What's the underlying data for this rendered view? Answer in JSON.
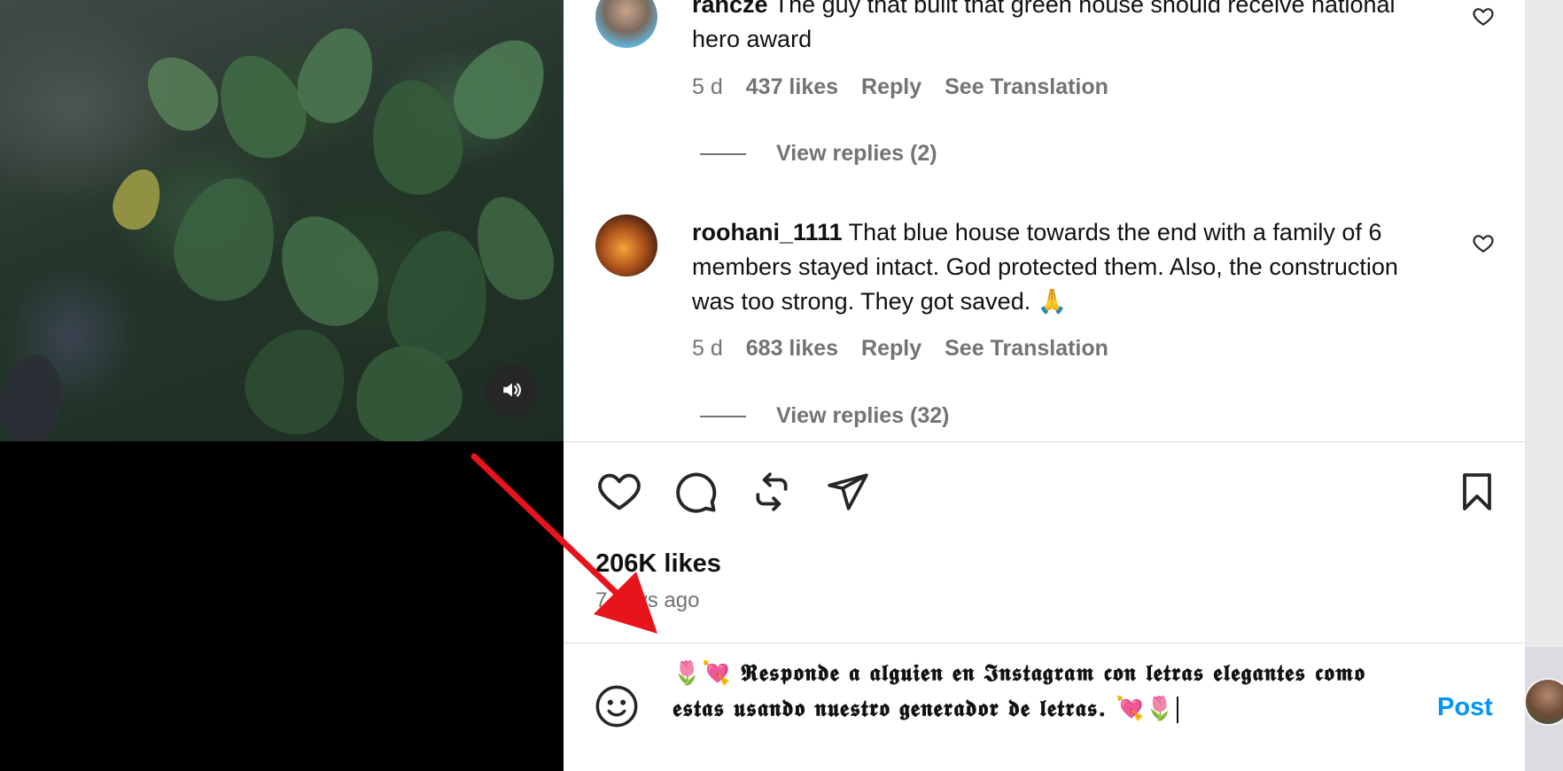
{
  "comments": [
    {
      "username": "rancze",
      "text": "The guy that built that green house should receive national hero award",
      "age": "5 d",
      "likes": "437 likes",
      "reply": "Reply",
      "translate": "See Translation",
      "view_replies": "View replies (2)",
      "icon": "heart-outline-icon"
    },
    {
      "username": "roohani_1111",
      "text": "That blue house towards the end with a family of 6 members stayed intact. God protected them. Also, the construction was too strong. They got saved. 🙏",
      "age": "5 d",
      "likes": "683 likes",
      "reply": "Reply",
      "translate": "See Translation",
      "view_replies": "View replies (32)",
      "icon": "heart-outline-icon"
    }
  ],
  "actions": {
    "like_icon": "heart-icon",
    "comment_icon": "comment-bubble-icon",
    "repost_icon": "repost-icon",
    "share_icon": "paper-plane-icon",
    "save_icon": "bookmark-icon"
  },
  "post": {
    "likes": "206K likes",
    "time_ago": "7 days ago"
  },
  "composer": {
    "emoji_icon": "smiley-face-icon",
    "value": "🌷💘 𝕽𝖊𝖘𝖕𝖔𝖓𝖉𝖊 𝖆 𝖆𝖑𝖌𝖚𝖎𝖊𝖓 𝖊𝖓 𝕴𝖓𝖘𝖙𝖆𝖌𝖗𝖆𝖒 𝖈𝖔𝖓 𝖑𝖊𝖙𝖗𝖆𝖘 𝖊𝖑𝖊𝖌𝖆𝖓𝖙𝖊𝖘 𝖈𝖔𝖒𝖔 𝖊𝖘𝖙𝖆𝖘 𝖚𝖘𝖆𝖓𝖉𝖔 𝖓𝖚𝖊𝖘𝖙𝖗𝖔 𝖌𝖊𝖓𝖊𝖗𝖆𝖉𝖔𝖗 𝖉𝖊 𝖑𝖊𝖙𝖗𝖆𝖘. 💘🌷",
    "post_label": "Post"
  },
  "video": {
    "mute_icon": "speaker-volume-icon"
  },
  "colors": {
    "accent": "#0095f6",
    "muted_text": "#737373",
    "annotation_arrow": "#e8141b"
  }
}
